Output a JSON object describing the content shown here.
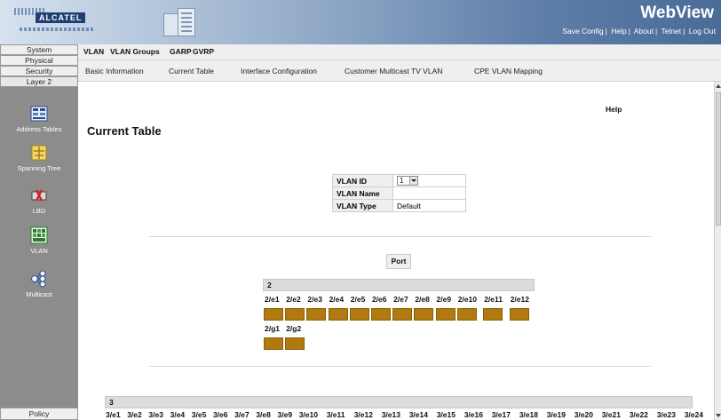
{
  "header": {
    "brand_logo": "ALCATEL",
    "app_title": "WebView",
    "links": [
      "Save Config",
      "Help",
      "About",
      "Telnet",
      "Log Out"
    ],
    "separator": "|"
  },
  "leftnav": {
    "tabs": [
      "System",
      "Physical",
      "Security",
      "Layer 2"
    ],
    "items": [
      {
        "label": "Address Tables",
        "icon": "address-tables-icon"
      },
      {
        "label": "Spanning Tree",
        "icon": "spanning-tree-icon"
      },
      {
        "label": "LBD",
        "icon": "lbd-icon"
      },
      {
        "label": "VLAN",
        "icon": "vlan-icon"
      },
      {
        "label": "Multicast",
        "icon": "multicast-icon"
      }
    ],
    "bottom_tab": "Policy"
  },
  "tabs": [
    "VLAN",
    "VLAN Groups",
    "GARP",
    "GVRP"
  ],
  "subtabs": [
    "Basic Information",
    "Current Table",
    "Interface Configuration",
    "Customer Multicast TV VLAN",
    "CPE VLAN Mapping"
  ],
  "content": {
    "help": "Help",
    "title": "Current Table",
    "vlan_table": {
      "id_label": "VLAN ID",
      "id_value": "1",
      "name_label": "VLAN Name",
      "name_value": "",
      "type_label": "VLAN Type",
      "type_value": "Default"
    },
    "port_button": "Port",
    "group2": {
      "label": "2",
      "ports_row1": [
        "2/e1",
        "2/e2",
        "2/e3",
        "2/e4",
        "2/e5",
        "2/e6",
        "2/e7",
        "2/e8",
        "2/e9",
        "2/e10",
        "2/e11",
        "2/e12"
      ],
      "ports_row2": [
        "2/g1",
        "2/g2"
      ]
    },
    "group3": {
      "label": "3",
      "ports_row1": [
        "3/e1",
        "3/e2",
        "3/e3",
        "3/e4",
        "3/e5",
        "3/e6",
        "3/e7",
        "3/e8",
        "3/e9",
        "3/e10",
        "3/e11",
        "3/e12",
        "3/e13",
        "3/e14",
        "3/e15",
        "3/e16",
        "3/e17",
        "3/e18",
        "3/e19",
        "3/e20",
        "3/e21",
        "3/e22",
        "3/e23",
        "3/e24"
      ]
    }
  },
  "colors": {
    "port_member": "#b07a10",
    "header_gradient_end": "#4a6b98"
  }
}
